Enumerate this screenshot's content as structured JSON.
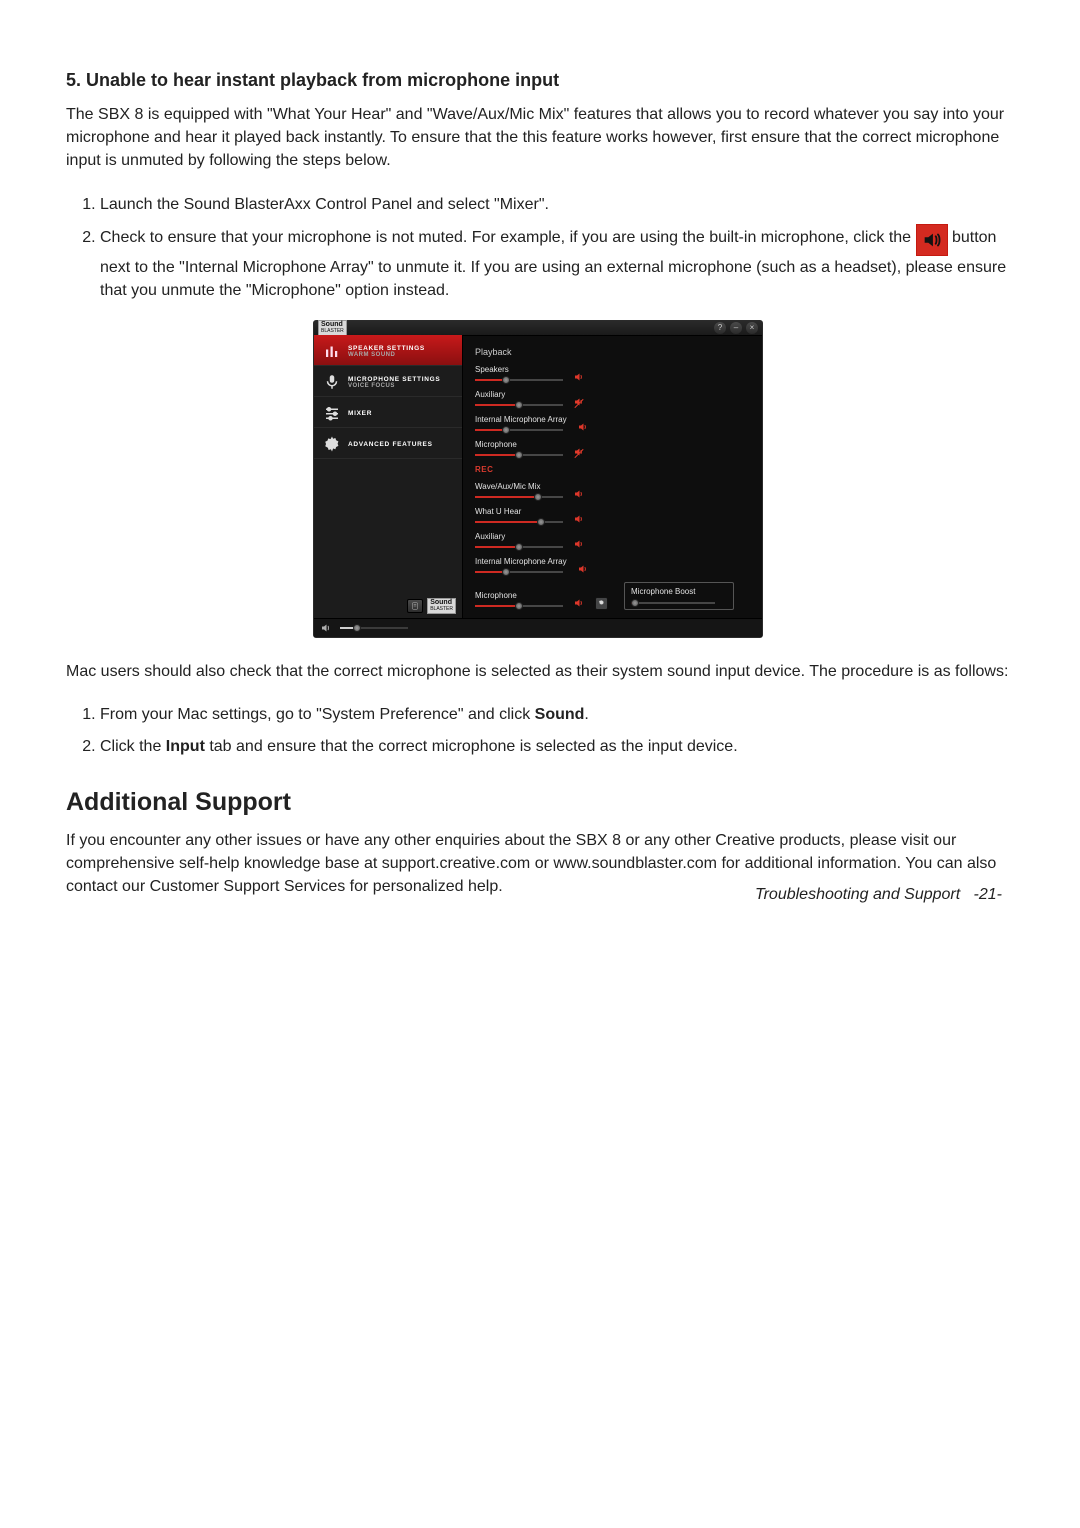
{
  "doc": {
    "section_title": "5. Unable to hear instant playback from microphone input",
    "section_paragraph": "The SBX 8 is equipped with \"What Your Hear\" and \"Wave/Aux/Mic Mix\" features that allows you to record whatever you say into your microphone and hear it played back instantly. To ensure that the this feature works however, first ensure that the correct microphone input is unmuted by following the steps below.",
    "steps_a": [
      "Launch the Sound BlasterAxx Control Panel and select \"Mixer\".",
      {
        "pre": "Check to ensure that your microphone is not muted. For example, if you are using the built-in microphone, click the ",
        "post": " button next to the \"Internal Microphone Array\" to unmute it. If you are using an external microphone (such as a headset), please ensure that you unmute the \"Microphone\" option instead."
      }
    ],
    "mac_intro": "Mac users should also check that the correct microphone is selected as their system sound input device. The procedure is as follows:",
    "steps_b": [
      {
        "pre": "From your Mac settings, go to \"System Preference\" and click ",
        "bold": "Sound",
        "post": "."
      },
      {
        "pre": "Click the ",
        "bold": "Input",
        "post": " tab and ensure that the correct microphone is selected as the input device."
      }
    ],
    "add_support_title": "Additional Support",
    "add_support_para": "If you encounter any other issues or have any other enquiries about the SBX 8 or any other Creative products, please visit our comprehensive self-help knowledge base at support.creative.com or www.soundblaster.com for additional information. You can also contact our Customer Support Services for personalized help.",
    "footer_section": "Troubleshooting and Support",
    "footer_page": "-21-"
  },
  "mixer": {
    "brand_top": "Sound",
    "brand_sub": "BLASTER",
    "win_icons": {
      "help": "?",
      "minimize": "–",
      "close": "×"
    },
    "sidebar": [
      {
        "title": "SPEAKER SETTINGS",
        "subtitle": "WARM SOUND",
        "icon": "eq-bars-icon",
        "active": true
      },
      {
        "title": "MICROPHONE SETTINGS",
        "subtitle": "VOICE FOCUS",
        "icon": "mic-icon",
        "active": false
      },
      {
        "title": "MIXER",
        "subtitle": "",
        "icon": "sliders-icon",
        "active": false
      },
      {
        "title": "ADVANCED FEATURES",
        "subtitle": "",
        "icon": "gear-icon",
        "active": false
      }
    ],
    "sidebar_footer_label": "Sound",
    "sidebar_footer_label_sub": "BLASTER",
    "playback": {
      "section_label": "Playback",
      "channels": [
        {
          "label": "Speakers",
          "value": 35,
          "mute_state": "unmuted"
        },
        {
          "label": "Auxiliary",
          "value": 50,
          "mute_state": "muted-struck"
        },
        {
          "label": "Internal Microphone Array",
          "value": 35,
          "mute_state": "unmuted"
        },
        {
          "label": "Microphone",
          "value": 50,
          "mute_state": "muted-struck"
        }
      ]
    },
    "rec": {
      "section_label": "REC",
      "channels": [
        {
          "label": "Wave/Aux/Mic Mix",
          "value": 72,
          "mute_state": "unmuted"
        },
        {
          "label": "What U Hear",
          "value": 75,
          "mute_state": "unmuted"
        },
        {
          "label": "Auxiliary",
          "value": 50,
          "mute_state": "unmuted"
        },
        {
          "label": "Internal Microphone Array",
          "value": 35,
          "mute_state": "unmuted"
        },
        {
          "label": "Microphone",
          "value": 50,
          "mute_state": "unmuted",
          "has_gear": true
        }
      ],
      "boost": {
        "label": "Microphone Boost",
        "value": 5
      }
    },
    "master_volume": 25
  }
}
